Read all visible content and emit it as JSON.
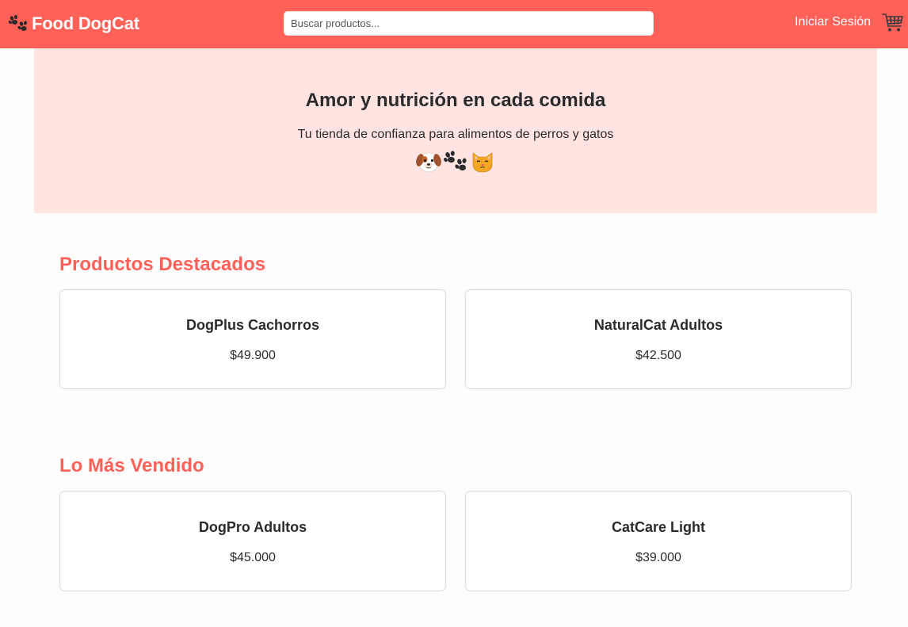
{
  "header": {
    "brand": "Food DogCat",
    "search_placeholder": "Buscar productos...",
    "login_label": "Iniciar Sesión",
    "brand_icon": "paw-icon",
    "cart_icon": "cart-icon",
    "bar_color": "#ff6159"
  },
  "hero": {
    "title": "Amor y nutrición en cada comida",
    "subtitle": "Tu tienda de confianza para alimentos de perros y gatos",
    "icons": [
      "dog-face-icon",
      "paw-prints-icon",
      "cat-face-icon"
    ],
    "background": "#ffe4e1"
  },
  "featured": {
    "title": "Productos Destacados",
    "products": [
      {
        "name": "DogPlus Cachorros",
        "price": "$49.900"
      },
      {
        "name": "NaturalCat Adultos",
        "price": "$42.500"
      }
    ]
  },
  "bestsellers": {
    "title": "Lo Más Vendido",
    "products": [
      {
        "name": "DogPro Adultos",
        "price": "$45.000"
      },
      {
        "name": "CatCare Light",
        "price": "$39.000"
      }
    ]
  },
  "accent_color": "#ff6159"
}
